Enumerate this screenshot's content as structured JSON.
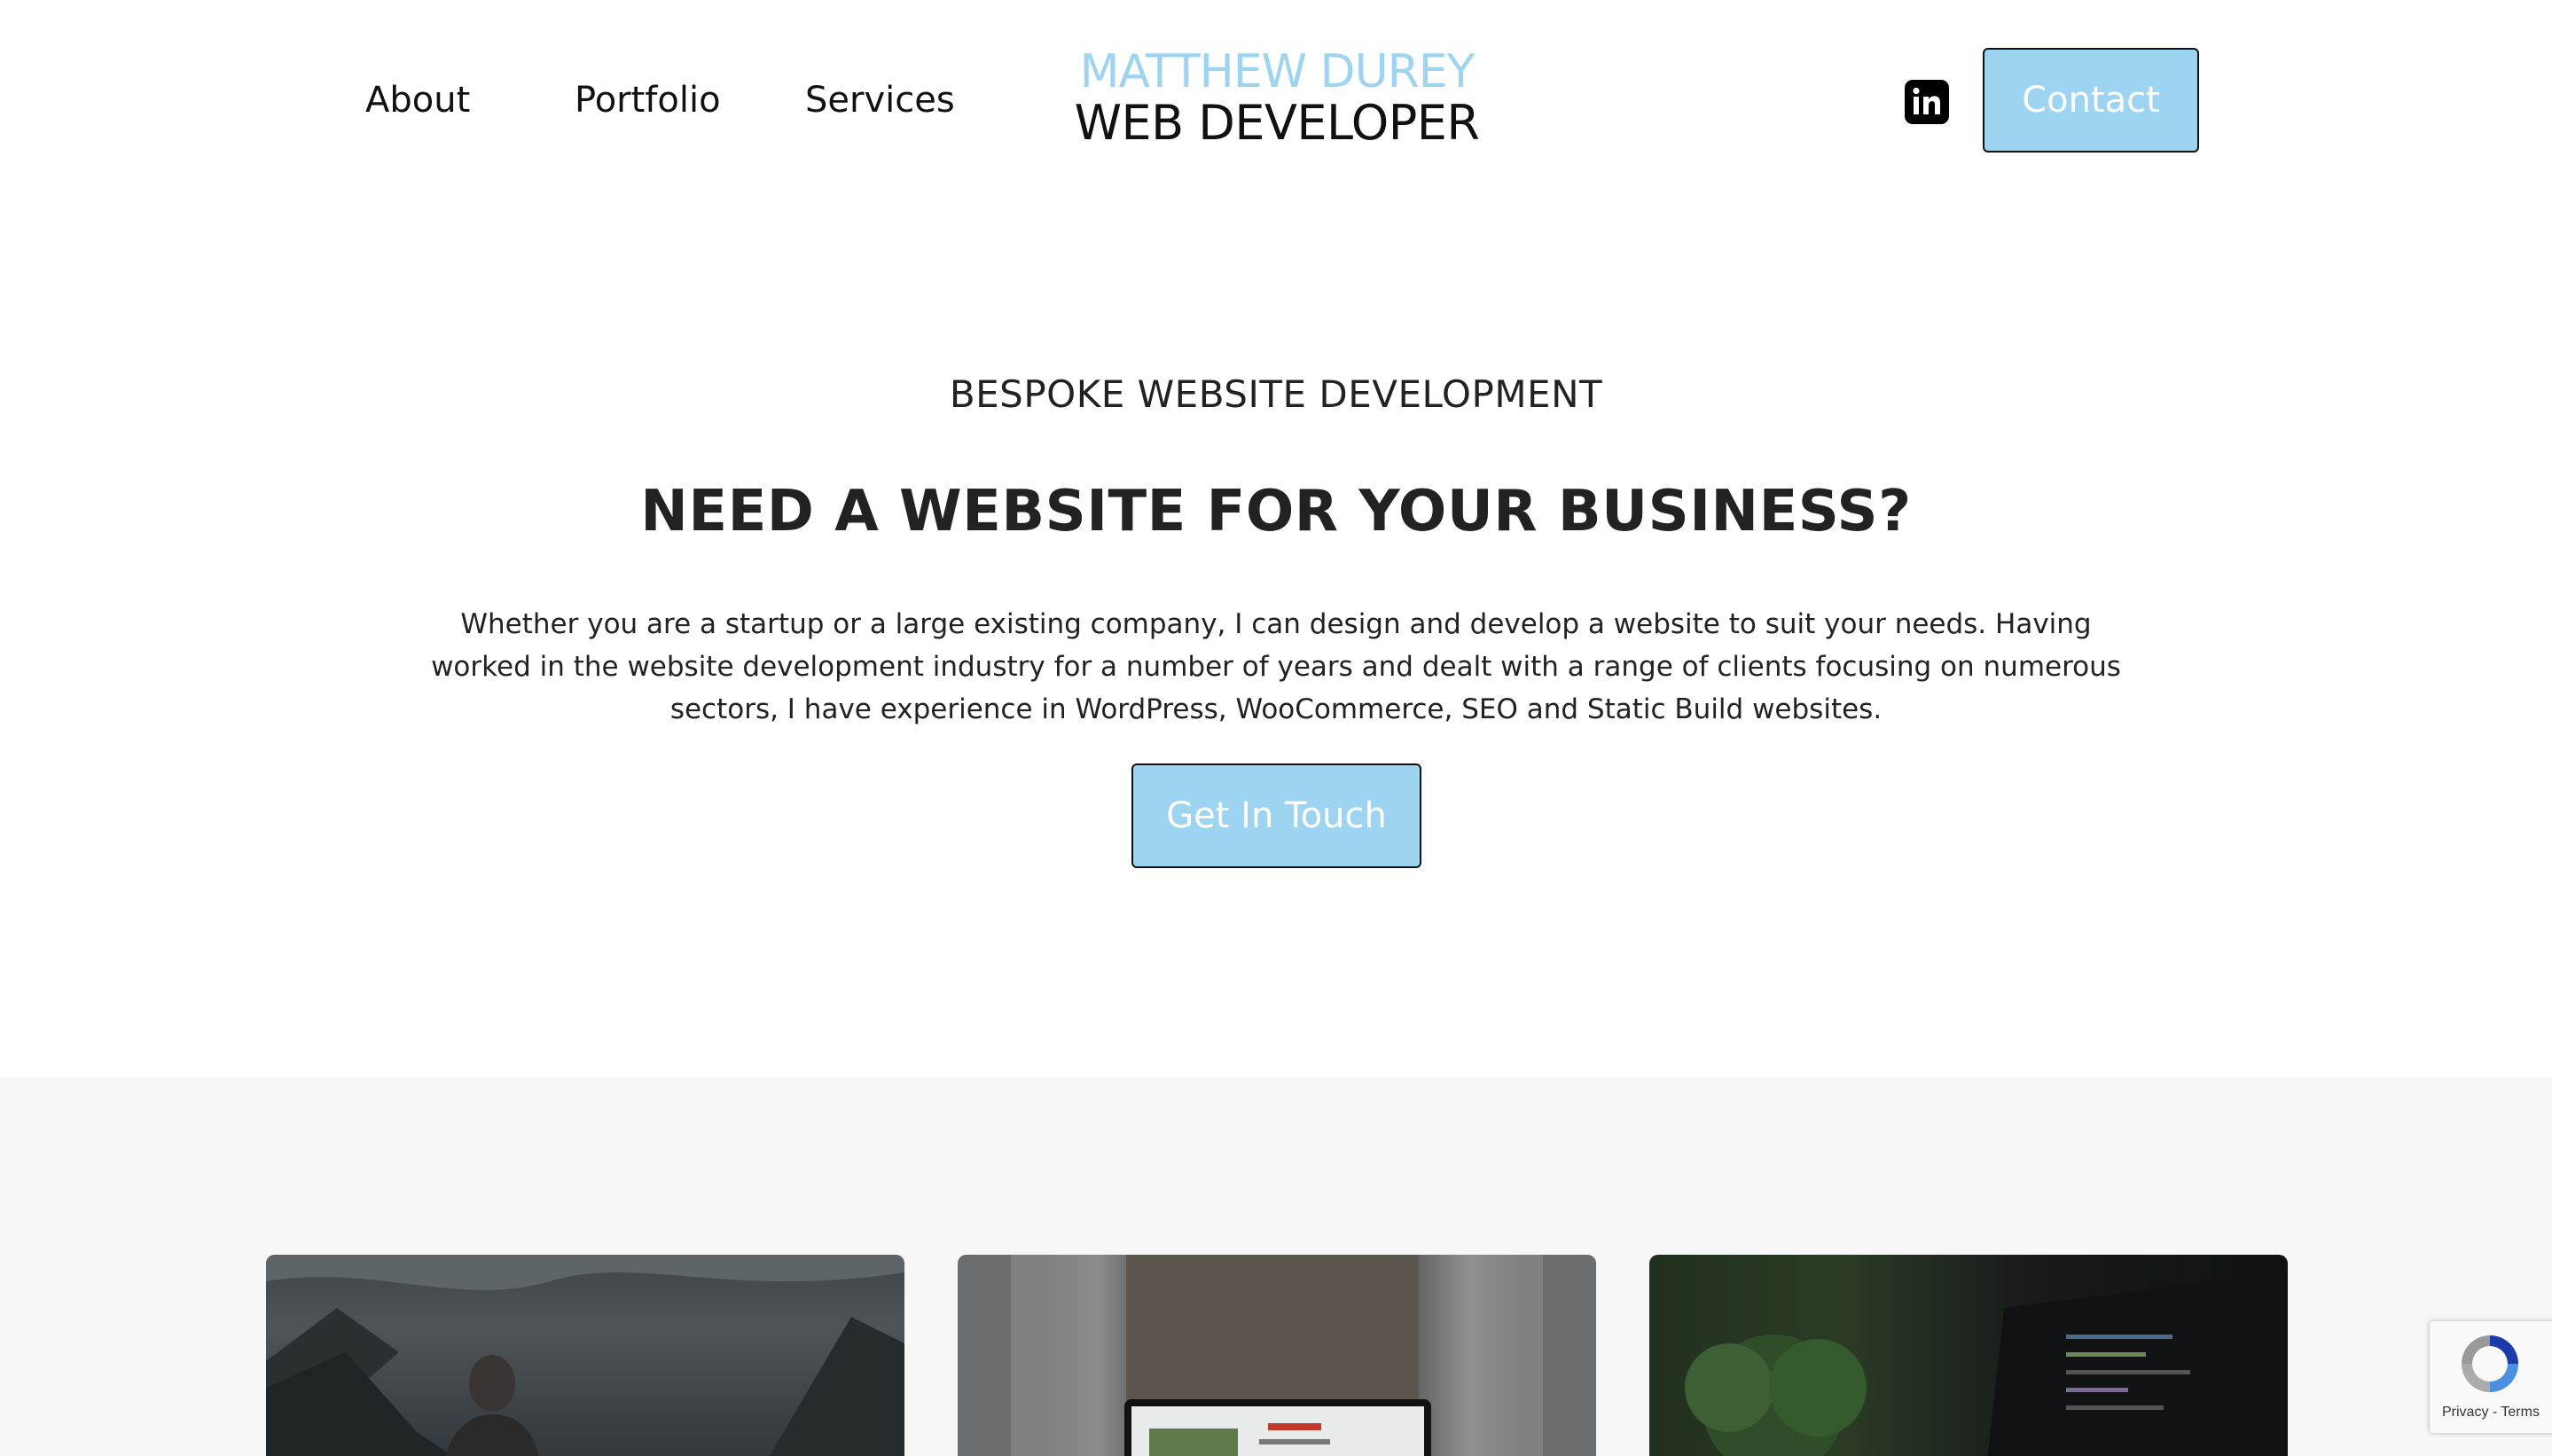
{
  "nav": {
    "items": [
      {
        "label": "About"
      },
      {
        "label": "Portfolio"
      },
      {
        "label": "Services"
      }
    ]
  },
  "logo": {
    "line1": "MATTHEW DUREY",
    "line2": "WEB DEVELOPER"
  },
  "header": {
    "linkedin_icon": "linkedin-icon",
    "contact_label": "Contact"
  },
  "hero": {
    "eyebrow": "BESPOKE WEBSITE DEVELOPMENT",
    "headline": "NEED A WEBSITE FOR YOUR BUSINESS?",
    "body": "Whether you are a startup or a large existing company, I can design and develop a website to suit your needs. Having worked in the website development industry for a number of years and dealt with a range of clients focusing on numerous sectors, I have experience in WordPress, WooCommerce, SEO and Static Build websites.",
    "cta_label": "Get In Touch"
  },
  "recaptcha": {
    "privacy": "Privacy",
    "separator": " - ",
    "terms": "Terms"
  },
  "colors": {
    "accent": "#9dd4f2",
    "text": "#111111",
    "section_bg": "#f7f7f7"
  }
}
